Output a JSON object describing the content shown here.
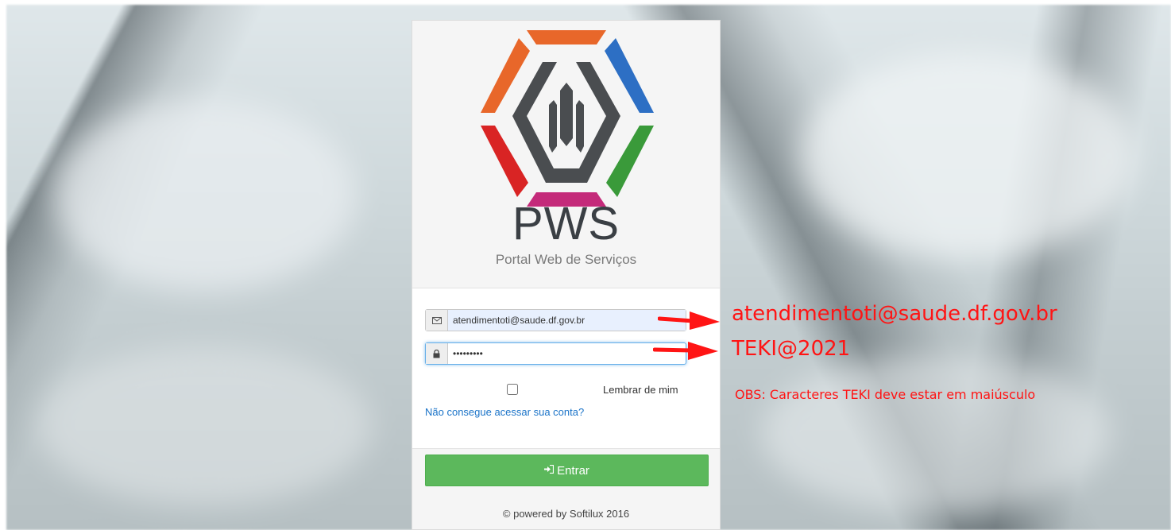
{
  "brand": {
    "name": "PWS",
    "subtitle": "Portal Web de Serviços"
  },
  "login": {
    "email_value": "atendimentoti@saude.df.gov.br",
    "password_value": "TEKI@2021",
    "remember_label": "Lembrar de mim",
    "forgot_link": "Não consegue acessar sua conta?",
    "submit_label": "Entrar",
    "footer": "© powered by Softilux 2016"
  },
  "annotations": {
    "email_note": "atendimentoti@saude.df.gov.br",
    "password_note": "TEKI@2021",
    "obs_note": "OBS: Caracteres TEKI deve estar em maiúsculo",
    "color": "#ff1414"
  },
  "icons": {
    "email": "envelope-icon",
    "password": "lock-icon",
    "submit": "sign-in-icon"
  },
  "colors": {
    "submit": "#5cb85c",
    "link": "#1a73c8",
    "logo_orange": "#e8672a",
    "logo_blue": "#2d6fc4",
    "logo_green": "#3a9a3a",
    "logo_red": "#d92424",
    "logo_magenta": "#c42a7a"
  }
}
